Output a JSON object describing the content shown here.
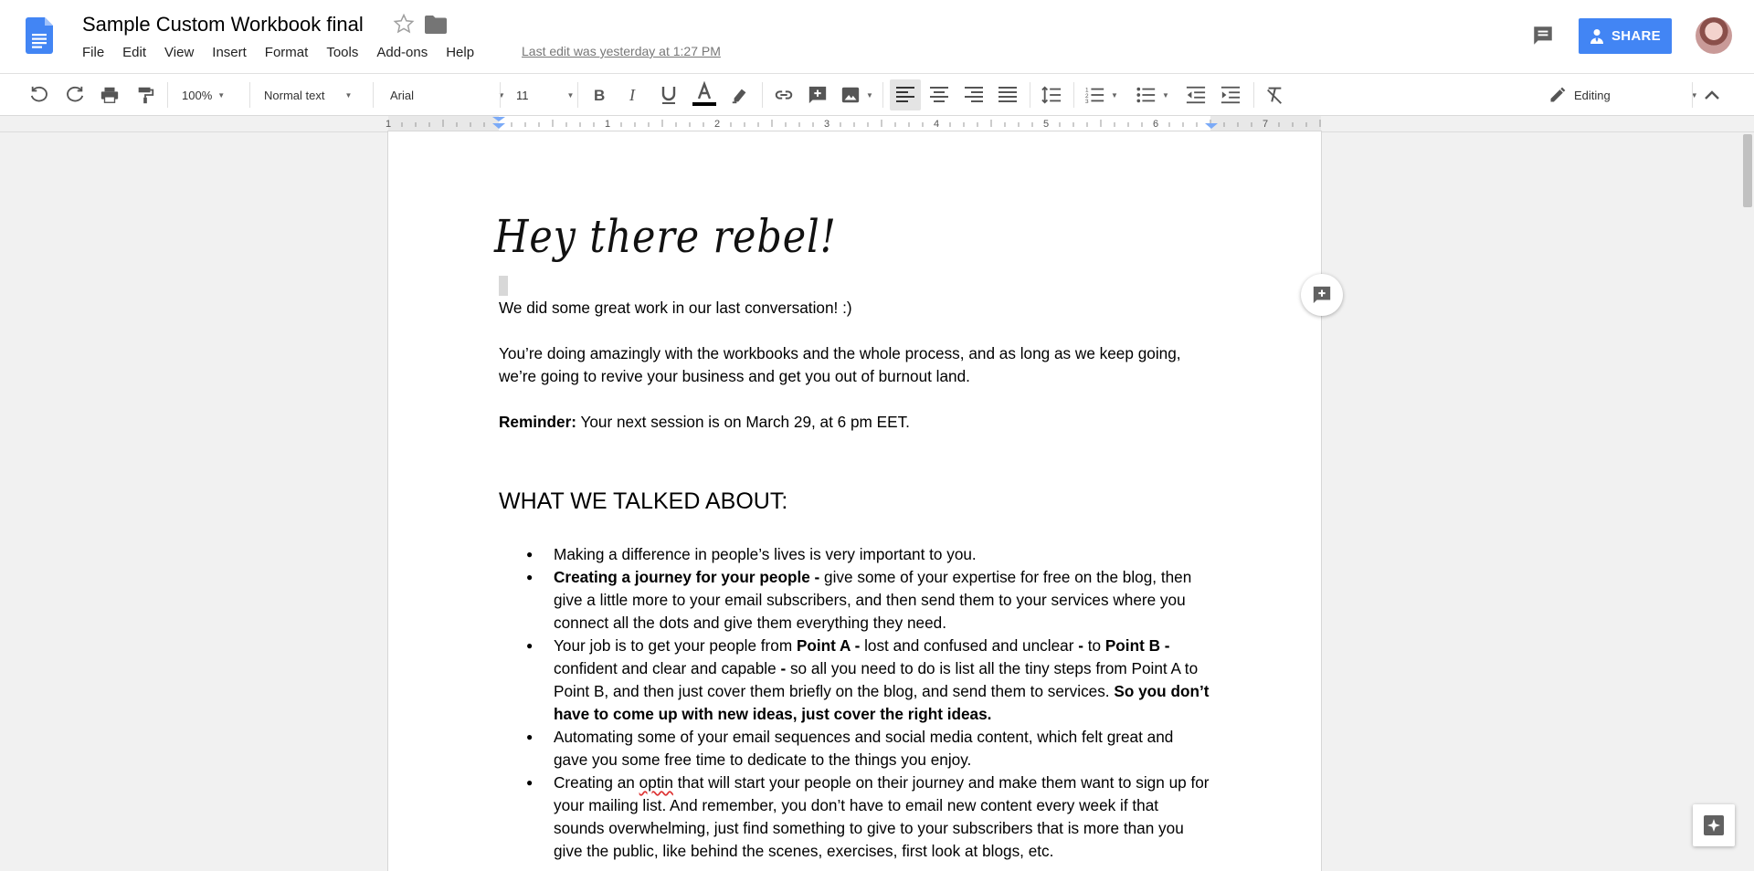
{
  "header": {
    "title": "Sample Custom Workbook final",
    "last_edit": "Last edit was yesterday at 1:27 PM",
    "share_label": "SHARE",
    "menu": [
      "File",
      "Edit",
      "View",
      "Insert",
      "Format",
      "Tools",
      "Add-ons",
      "Help"
    ]
  },
  "toolbar": {
    "zoom": "100%",
    "style": "Normal text",
    "font": "Arial",
    "font_size": "11",
    "mode": "Editing"
  },
  "ruler": {
    "numbers": [
      "1",
      "1",
      "2",
      "3",
      "4",
      "5",
      "6",
      "7"
    ]
  },
  "document": {
    "heading": "Hey there rebel!",
    "p1": "We did some great work in our last conversation! :)",
    "p2": "You’re doing amazingly with the workbooks and the whole process, and as long as we keep going, we’re going to revive your business and get you out of burnout land.",
    "reminder_label": "Reminder:",
    "reminder_text": " Your next session is on March 29, at 6 pm EET.",
    "section_title": "WHAT WE TALKED ABOUT:",
    "b1": "Making a difference in people’s lives is very important to you.",
    "b2_bold": "Creating a journey for your people -",
    "b2_text": " give some of your expertise for free on the blog, then give a little more to your email subscribers, and then send them to your services where you connect all the dots and give them everything they need.",
    "b3_a": "Your job is to get your people from ",
    "b3_b": "Point A -",
    "b3_c": " lost and confused and unclear ",
    "b3_d": "-",
    "b3_e": " to ",
    "b3_f": "Point B -",
    "b3_g": " confident and clear and capable ",
    "b3_h": "-",
    "b3_i": " so all you need to do is list all the tiny steps from Point A to Point B, and then just cover them briefly on the blog, and send them to services. ",
    "b3_j": "So you don’t have to come up with new ideas, just cover the right ideas.",
    "b4": "Automating some of your email sequences and social media content, which felt great and gave you some free time to dedicate to the things you enjoy.",
    "b5_a": "Creating an ",
    "b5_b": "optin",
    "b5_c": " that will start your people on their journey and make them want to sign up for your mailing list. And remember, you don’t have to email new content every week if that sounds overwhelming, just find something to give to your subscribers that is more than you give the public, like behind the scenes, exercises, first look at blogs, etc."
  },
  "colors": {
    "share_bg": "#4285f4",
    "docs_blue": "#4285f4",
    "text_color_bar": "#000000",
    "ruler_marker": "#7baaf7"
  },
  "icons": {
    "logo": "google-docs-icon",
    "star": "star-icon",
    "folder": "folder-icon",
    "comments": "comments-icon",
    "share": "share-person-icon"
  }
}
